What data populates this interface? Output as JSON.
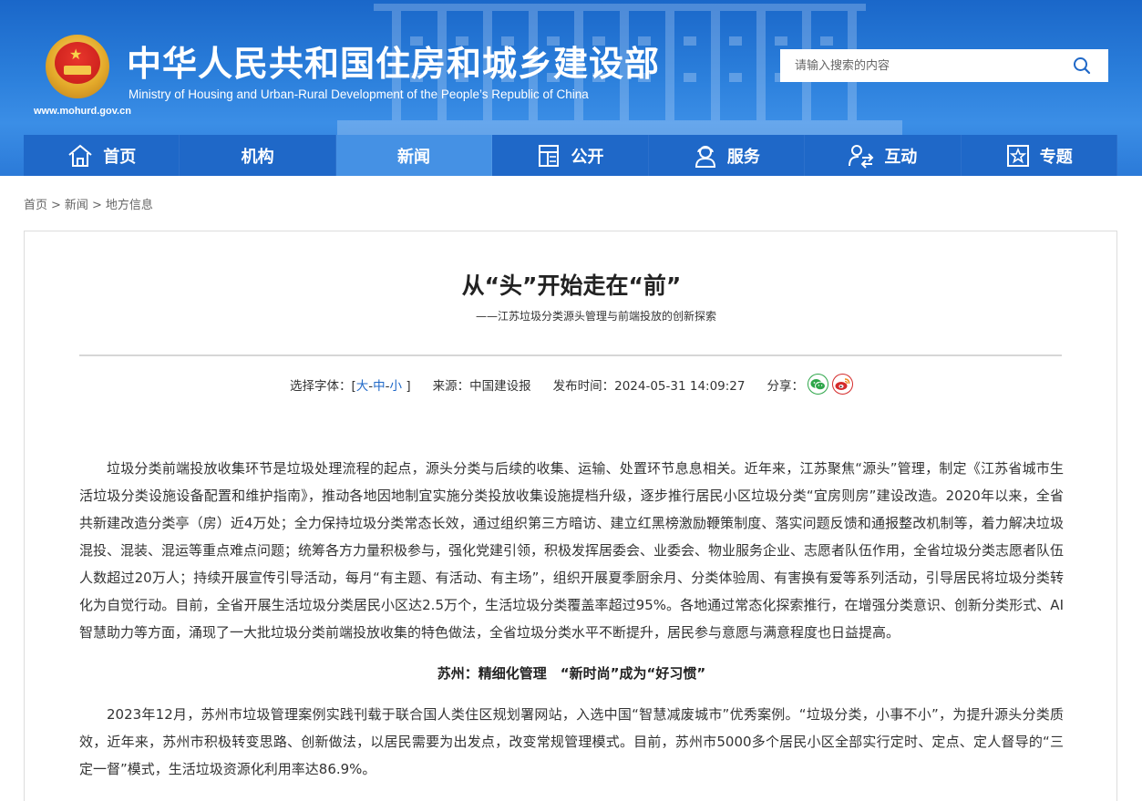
{
  "site": {
    "title": "中华人民共和国住房和城乡建设部",
    "subtitle": "Ministry of Housing and Urban-Rural Development of the People’s Republic of China",
    "url": "www.mohurd.gov.cn"
  },
  "search": {
    "placeholder": "请输入搜索的内容",
    "icon": "search-icon"
  },
  "nav": {
    "items": [
      {
        "label": "首页",
        "icon": "home-icon"
      },
      {
        "label": "机构",
        "icon": ""
      },
      {
        "label": "新闻",
        "icon": "",
        "active": true
      },
      {
        "label": "公开",
        "icon": "document-icon"
      },
      {
        "label": "服务",
        "icon": "service-person-icon"
      },
      {
        "label": "互动",
        "icon": "interaction-icon"
      },
      {
        "label": "专题",
        "icon": "star-frame-icon"
      }
    ]
  },
  "breadcrumb": {
    "items": [
      "首页",
      "新闻",
      "地方信息"
    ],
    "separator": ">"
  },
  "article": {
    "title": "从“头”开始走在“前”",
    "subtitle": "——江苏垃圾分类源头管理与前端投放的创新探索",
    "meta": {
      "font_label": "选择字体：[",
      "font_large": "大",
      "font_medium": "中",
      "font_small": "小",
      "font_dash": "-",
      "font_close": "]",
      "source": "来源：中国建设报",
      "pubtime": "发布时间：2024-05-31 14:09:27",
      "share_label": "分享："
    },
    "paragraph1": "垃圾分类前端投放收集环节是垃圾处理流程的起点，源头分类与后续的收集、运输、处置环节息息相关。近年来，江苏聚焦“源头”管理，制定《江苏省城市生活垃圾分类设施设备配置和维护指南》，推动各地因地制宜实施分类投放收集设施提档升级，逐步推行居民小区垃圾分类“宜房则房”建设改造。2020年以来，全省共新建改造分类亭（房）近4万处；全力保持垃圾分类常态长效，通过组织第三方暗访、建立红黑榜激励鞭策制度、落实问题反馈和通报整改机制等，着力解决垃圾混投、混装、混运等重点难点问题；统筹各方力量积极参与，强化党建引领，积极发挥居委会、业委会、物业服务企业、志愿者队伍作用，全省垃圾分类志愿者队伍人数超过20万人；持续开展宣传引导活动，每月“有主题、有活动、有主场”，组织开展夏季厨余月、分类体验周、有害换有爱等系列活动，引导居民将垃圾分类转化为自觉行动。目前，全省开展生活垃圾分类居民小区达2.5万个，生活垃圾分类覆盖率超过95%。各地通过常态化探索推行，在增强分类意识、创新分类形式、AI智慧助力等方面，涌现了一大批垃圾分类前端投放收集的特色做法，全省垃圾分类水平不断提升，居民参与意愿与满意程度也日益提高。",
    "section_heading": "苏州：精细化管理　“新时尚”成为“好习惯”",
    "paragraph2": "2023年12月，苏州市垃圾管理案例实践刊载于联合国人类住区规划署网站，入选中国“智慧减废城市”优秀案例。“垃圾分类，小事不小”，为提升源头分类质效，近年来，苏州市积极转变思路、创新做法，以居民需要为出发点，改变常规管理模式。目前，苏州市5000多个居民小区全部实行定时、定点、定人督导的“三定一督”模式，生活垃圾资源化利用率达86.9%。"
  },
  "colors": {
    "nav_bg": "#1f68c8",
    "nav_active": "#4591e4",
    "header_blue": "#2c80dc",
    "link_blue": "#1f68c8"
  }
}
